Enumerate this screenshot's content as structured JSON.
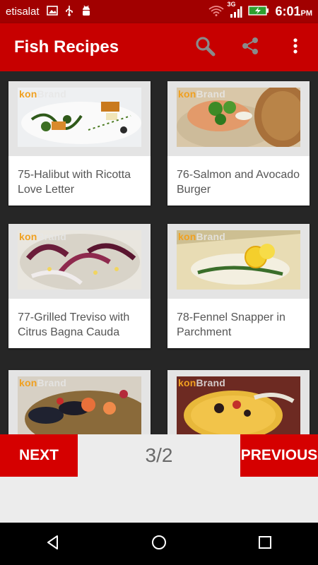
{
  "status_bar": {
    "carrier": "etisalat",
    "network": "3G",
    "time": "6:01",
    "ampm": "PM"
  },
  "app_bar": {
    "title": "Fish Recipes",
    "actions": [
      "search-icon",
      "share-icon",
      "overflow-menu-icon"
    ]
  },
  "recipes": [
    {
      "title": "75-Halibut with Ricotta Love Letter",
      "brand_prefix": "kon",
      "brand_suffix": "Brand"
    },
    {
      "title": "76-Salmon and Avocado Burger",
      "brand_prefix": "kon",
      "brand_suffix": "Brand"
    },
    {
      "title": "77-Grilled Treviso with Citrus Bagna Cauda",
      "brand_prefix": "kon",
      "brand_suffix": "Brand"
    },
    {
      "title": "78-Fennel Snapper in Parchment",
      "brand_prefix": "kon",
      "brand_suffix": "Brand"
    },
    {
      "title": "",
      "brand_prefix": "kon",
      "brand_suffix": "Brand"
    },
    {
      "title": "",
      "brand_prefix": "kon",
      "brand_suffix": "Brand"
    }
  ],
  "pager": {
    "next_label": "NEXT",
    "page_indicator": "3/2",
    "previous_label": "PREVIOUS"
  },
  "colors": {
    "status_bar": "#a10000",
    "app_bar": "#c70000",
    "button": "#d50000",
    "grid_background": "#262626"
  }
}
